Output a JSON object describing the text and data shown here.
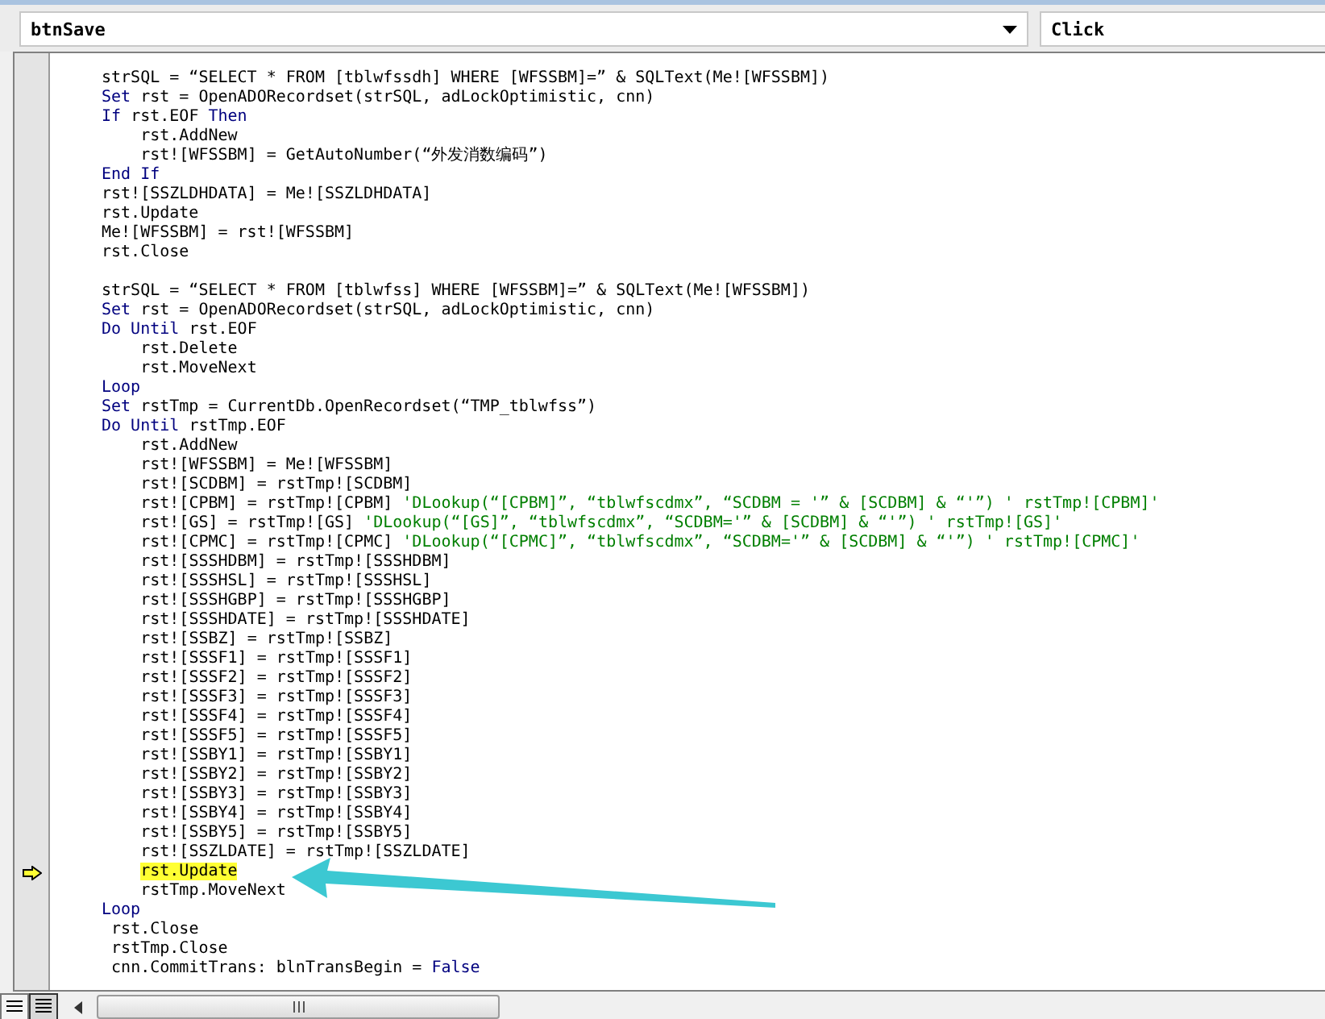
{
  "object_box": {
    "value": "btnSave"
  },
  "procedure_box": {
    "value": "Click"
  },
  "code_lines": [
    {
      "kind": "code",
      "current": false,
      "tokens": [
        {
          "kind": "plain",
          "text": "strSQL = “SELECT * FROM [tblwfssdh] WHERE [WFSSBM]=” & SQLText(Me![WFSSBM])"
        }
      ]
    },
    {
      "kind": "code",
      "current": false,
      "tokens": [
        {
          "kind": "keyword",
          "text": "Set"
        },
        {
          "kind": "plain",
          "text": " rst = OpenADORecordset(strSQL, adLockOptimistic, cnn)"
        }
      ]
    },
    {
      "kind": "code",
      "current": false,
      "tokens": [
        {
          "kind": "keyword",
          "text": "If"
        },
        {
          "kind": "plain",
          "text": " rst.EOF "
        },
        {
          "kind": "keyword",
          "text": "Then"
        }
      ]
    },
    {
      "kind": "code",
      "current": false,
      "tokens": [
        {
          "kind": "plain",
          "text": "    rst.AddNew"
        }
      ]
    },
    {
      "kind": "code",
      "current": false,
      "tokens": [
        {
          "kind": "plain",
          "text": "    rst![WFSSBM] = GetAutoNumber(“外发消数编码”)"
        }
      ]
    },
    {
      "kind": "code",
      "current": false,
      "tokens": [
        {
          "kind": "keyword",
          "text": "End If"
        }
      ]
    },
    {
      "kind": "code",
      "current": false,
      "tokens": [
        {
          "kind": "plain",
          "text": "rst![SSZLDHDATA] = Me![SSZLDHDATA]"
        }
      ]
    },
    {
      "kind": "code",
      "current": false,
      "tokens": [
        {
          "kind": "plain",
          "text": "rst.Update"
        }
      ]
    },
    {
      "kind": "code",
      "current": false,
      "tokens": [
        {
          "kind": "plain",
          "text": "Me![WFSSBM] = rst![WFSSBM]"
        }
      ]
    },
    {
      "kind": "code",
      "current": false,
      "tokens": [
        {
          "kind": "plain",
          "text": "rst.Close"
        }
      ]
    },
    {
      "kind": "blank"
    },
    {
      "kind": "code",
      "current": false,
      "tokens": [
        {
          "kind": "plain",
          "text": "strSQL = “SELECT * FROM [tblwfss] WHERE [WFSSBM]=” & SQLText(Me![WFSSBM])"
        }
      ]
    },
    {
      "kind": "code",
      "current": false,
      "tokens": [
        {
          "kind": "keyword",
          "text": "Set"
        },
        {
          "kind": "plain",
          "text": " rst = OpenADORecordset(strSQL, adLockOptimistic, cnn)"
        }
      ]
    },
    {
      "kind": "code",
      "current": false,
      "tokens": [
        {
          "kind": "keyword",
          "text": "Do Until"
        },
        {
          "kind": "plain",
          "text": " rst.EOF"
        }
      ]
    },
    {
      "kind": "code",
      "current": false,
      "tokens": [
        {
          "kind": "plain",
          "text": "    rst.Delete"
        }
      ]
    },
    {
      "kind": "code",
      "current": false,
      "tokens": [
        {
          "kind": "plain",
          "text": "    rst.MoveNext"
        }
      ]
    },
    {
      "kind": "code",
      "current": false,
      "tokens": [
        {
          "kind": "keyword",
          "text": "Loop"
        }
      ]
    },
    {
      "kind": "code",
      "current": false,
      "tokens": [
        {
          "kind": "keyword",
          "text": "Set"
        },
        {
          "kind": "plain",
          "text": " rstTmp = CurrentDb.OpenRecordset(“TMP_tblwfss”)"
        }
      ]
    },
    {
      "kind": "code",
      "current": false,
      "tokens": [
        {
          "kind": "keyword",
          "text": "Do Until"
        },
        {
          "kind": "plain",
          "text": " rstTmp.EOF"
        }
      ]
    },
    {
      "kind": "code",
      "current": false,
      "tokens": [
        {
          "kind": "plain",
          "text": "    rst.AddNew"
        }
      ]
    },
    {
      "kind": "code",
      "current": false,
      "tokens": [
        {
          "kind": "plain",
          "text": "    rst![WFSSBM] = Me![WFSSBM]"
        }
      ]
    },
    {
      "kind": "code",
      "current": false,
      "tokens": [
        {
          "kind": "plain",
          "text": "    rst![SCDBM] = rstTmp![SCDBM]"
        }
      ]
    },
    {
      "kind": "code",
      "current": false,
      "tokens": [
        {
          "kind": "plain",
          "text": "    rst![CPBM] = rstTmp![CPBM] "
        },
        {
          "kind": "comment",
          "text": "'DLookup(“[CPBM]”, “tblwfscdmx”, “SCDBM = '” & [SCDBM] & “'”) ' rstTmp![CPBM]'"
        }
      ]
    },
    {
      "kind": "code",
      "current": false,
      "tokens": [
        {
          "kind": "plain",
          "text": "    rst![GS] = rstTmp![GS] "
        },
        {
          "kind": "comment",
          "text": "'DLookup(“[GS]”, “tblwfscdmx”, “SCDBM='” & [SCDBM] & “'”) ' rstTmp![GS]'"
        }
      ]
    },
    {
      "kind": "code",
      "current": false,
      "tokens": [
        {
          "kind": "plain",
          "text": "    rst![CPMC] = rstTmp![CPMC] "
        },
        {
          "kind": "comment",
          "text": "'DLookup(“[CPMC]”, “tblwfscdmx”, “SCDBM='” & [SCDBM] & “'”) ' rstTmp![CPMC]'"
        }
      ]
    },
    {
      "kind": "code",
      "current": false,
      "tokens": [
        {
          "kind": "plain",
          "text": "    rst![SSSHDBM] = rstTmp![SSSHDBM]"
        }
      ]
    },
    {
      "kind": "code",
      "current": false,
      "tokens": [
        {
          "kind": "plain",
          "text": "    rst![SSSHSL] = rstTmp![SSSHSL]"
        }
      ]
    },
    {
      "kind": "code",
      "current": false,
      "tokens": [
        {
          "kind": "plain",
          "text": "    rst![SSSHGBP] = rstTmp![SSSHGBP]"
        }
      ]
    },
    {
      "kind": "code",
      "current": false,
      "tokens": [
        {
          "kind": "plain",
          "text": "    rst![SSSHDATE] = rstTmp![SSSHDATE]"
        }
      ]
    },
    {
      "kind": "code",
      "current": false,
      "tokens": [
        {
          "kind": "plain",
          "text": "    rst![SSBZ] = rstTmp![SSBZ]"
        }
      ]
    },
    {
      "kind": "code",
      "current": false,
      "tokens": [
        {
          "kind": "plain",
          "text": "    rst![SSSF1] = rstTmp![SSSF1]"
        }
      ]
    },
    {
      "kind": "code",
      "current": false,
      "tokens": [
        {
          "kind": "plain",
          "text": "    rst![SSSF2] = rstTmp![SSSF2]"
        }
      ]
    },
    {
      "kind": "code",
      "current": false,
      "tokens": [
        {
          "kind": "plain",
          "text": "    rst![SSSF3] = rstTmp![SSSF3]"
        }
      ]
    },
    {
      "kind": "code",
      "current": false,
      "tokens": [
        {
          "kind": "plain",
          "text": "    rst![SSSF4] = rstTmp![SSSF4]"
        }
      ]
    },
    {
      "kind": "code",
      "current": false,
      "tokens": [
        {
          "kind": "plain",
          "text": "    rst![SSSF5] = rstTmp![SSSF5]"
        }
      ]
    },
    {
      "kind": "code",
      "current": false,
      "tokens": [
        {
          "kind": "plain",
          "text": "    rst![SSBY1] = rstTmp![SSBY1]"
        }
      ]
    },
    {
      "kind": "code",
      "current": false,
      "tokens": [
        {
          "kind": "plain",
          "text": "    rst![SSBY2] = rstTmp![SSBY2]"
        }
      ]
    },
    {
      "kind": "code",
      "current": false,
      "tokens": [
        {
          "kind": "plain",
          "text": "    rst![SSBY3] = rstTmp![SSBY3]"
        }
      ]
    },
    {
      "kind": "code",
      "current": false,
      "tokens": [
        {
          "kind": "plain",
          "text": "    rst![SSBY4] = rstTmp![SSBY4]"
        }
      ]
    },
    {
      "kind": "code",
      "current": false,
      "tokens": [
        {
          "kind": "plain",
          "text": "    rst![SSBY5] = rstTmp![SSBY5]"
        }
      ]
    },
    {
      "kind": "code",
      "current": false,
      "tokens": [
        {
          "kind": "plain",
          "text": "    rst![SSZLDATE] = rstTmp![SSZLDATE]"
        }
      ]
    },
    {
      "kind": "code",
      "current": true,
      "tokens": [
        {
          "kind": "plain",
          "text": "    rst.Update"
        }
      ]
    },
    {
      "kind": "code",
      "current": false,
      "tokens": [
        {
          "kind": "plain",
          "text": "    rstTmp.MoveNext"
        }
      ]
    },
    {
      "kind": "code",
      "current": false,
      "tokens": [
        {
          "kind": "keyword",
          "text": "Loop"
        }
      ]
    },
    {
      "kind": "code",
      "current": false,
      "tokens": [
        {
          "kind": "plain",
          "text": " rst.Close"
        }
      ]
    },
    {
      "kind": "code",
      "current": false,
      "tokens": [
        {
          "kind": "plain",
          "text": " rstTmp.Close"
        }
      ]
    },
    {
      "kind": "code",
      "current": false,
      "tokens": [
        {
          "kind": "plain",
          "text": " cnn.CommitTrans: blnTransBegin = "
        },
        {
          "kind": "keyword",
          "text": "False"
        }
      ]
    }
  ]
}
